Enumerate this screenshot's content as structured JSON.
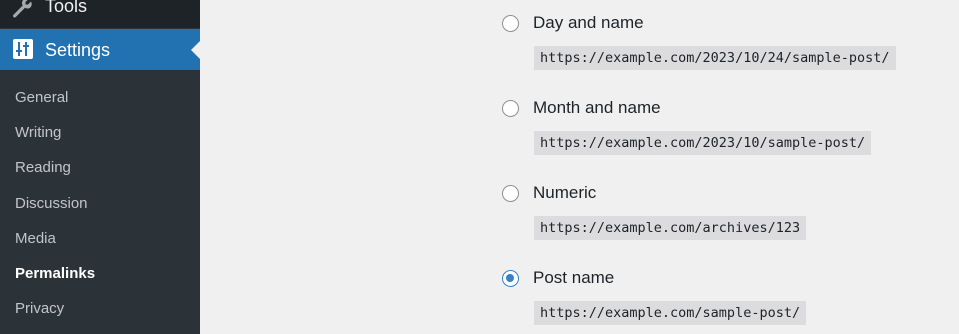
{
  "sidebar": {
    "tools": {
      "label": "Tools",
      "icon": "wrench-icon"
    },
    "settings": {
      "label": "Settings",
      "icon": "settings-sliders-icon"
    },
    "submenu": [
      {
        "label": "General"
      },
      {
        "label": "Writing"
      },
      {
        "label": "Reading"
      },
      {
        "label": "Discussion"
      },
      {
        "label": "Media"
      },
      {
        "label": "Permalinks",
        "current": true
      },
      {
        "label": "Privacy"
      }
    ]
  },
  "permalink_options": [
    {
      "label": "Day and name",
      "example": "https://example.com/2023/10/24/sample-post/",
      "checked": false
    },
    {
      "label": "Month and name",
      "example": "https://example.com/2023/10/sample-post/",
      "checked": false
    },
    {
      "label": "Numeric",
      "example": "https://example.com/archives/123",
      "checked": false
    },
    {
      "label": "Post name",
      "example": "https://example.com/sample-post/",
      "checked": true
    }
  ],
  "colors": {
    "sidebar_bg": "#2c3338",
    "active_bg": "#2271b1",
    "radio_checked": "#3582c4",
    "page_bg": "#f0f0f1"
  }
}
